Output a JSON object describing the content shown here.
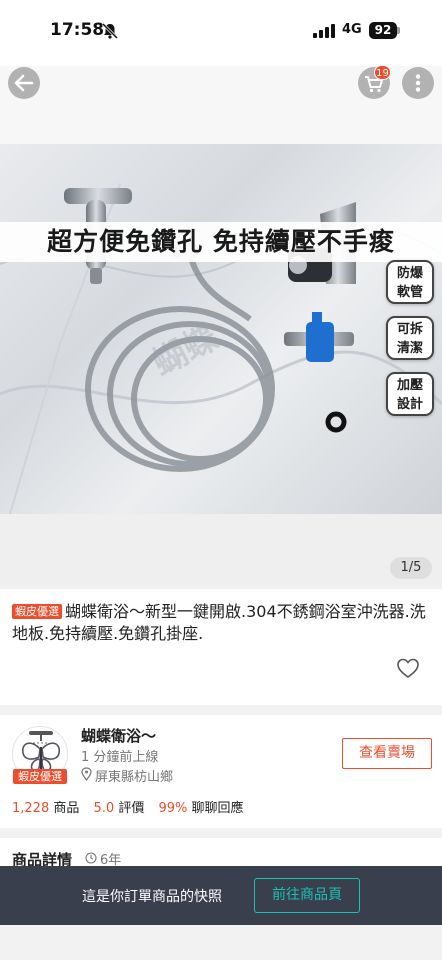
{
  "status_bar": {
    "time": "17:58",
    "network": "4G",
    "battery": "92",
    "icons": [
      "bell-slash-icon",
      "signal-icon"
    ]
  },
  "gallery": {
    "headline": "超方便免鑽孔 免持續壓不手痠",
    "features": [
      [
        "防爆",
        "軟管"
      ],
      [
        "可拆",
        "清潔"
      ],
      [
        "加壓",
        "設計"
      ]
    ],
    "watermark": "蝴蝶",
    "counter": "1/5",
    "cart_count": "19",
    "icons": [
      "back-arrow-icon",
      "cart-icon",
      "more-icon"
    ]
  },
  "product": {
    "badge": "蝦皮優選",
    "title": "蝴蝶衛浴～新型一鍵開啟.304不銹鋼浴室沖洗器.洗地板.免持續壓.免鑽孔掛座.",
    "icons": [
      "heart-icon"
    ]
  },
  "shop": {
    "name": "蝴蝶衛浴～",
    "online": "1 分鐘前上線",
    "location": "屏東縣枋山鄉",
    "badge": "蝦皮優選",
    "view_button": "查看賣場",
    "products_count": "1,228",
    "products_label": "商品",
    "rating": "5.0",
    "rating_label": "評價",
    "chat_rate": "99%",
    "chat_label": "聊聊回應",
    "icons": [
      "butterfly-logo-icon",
      "location-pin-icon"
    ]
  },
  "details": {
    "title": "商品詳情",
    "years": "6年",
    "icons": [
      "clock-icon"
    ]
  },
  "snapshot": {
    "text": "這是你訂單商品的快照",
    "button": "前往商品頁"
  },
  "colors": {
    "accent": "#ee4d2d",
    "teal": "#19c2b3",
    "snapshot_bg": "#3a3f4d"
  }
}
